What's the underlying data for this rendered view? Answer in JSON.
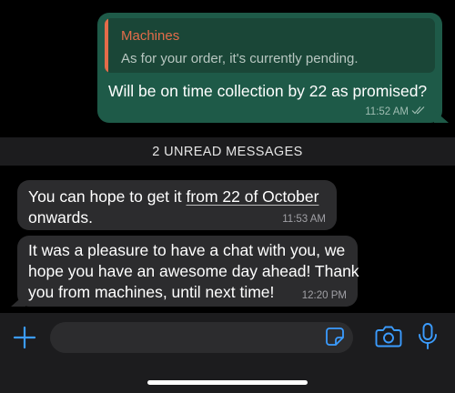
{
  "outgoing": {
    "quote_author": "Machines",
    "quote_text": "As for your order, it's currently pending.",
    "text": "Will be on time collection by 22 as promised?",
    "time": "11:52 AM"
  },
  "divider": {
    "label": "2 UNREAD MESSAGES"
  },
  "incoming": [
    {
      "line1_prefix": "You can hope to get it ",
      "line1_link": "from 22 of October",
      "line2": "onwards.",
      "time": "11:53 AM"
    },
    {
      "line1": "It was a pleasure to have a chat with you, we",
      "line2": "hope you have an awesome day ahead! Thank",
      "line3": "you from machines, until next time!",
      "time": "12:20 PM"
    }
  ],
  "composer": {
    "placeholder": "",
    "icons": [
      "plus-icon",
      "sticker-icon",
      "camera-icon",
      "microphone-icon"
    ]
  },
  "colors": {
    "outgoing_bubble": "#1e5a48",
    "incoming_bubble": "#2c2c2e",
    "accent": "#3b9cff",
    "quote_author": "#e36c4a"
  }
}
